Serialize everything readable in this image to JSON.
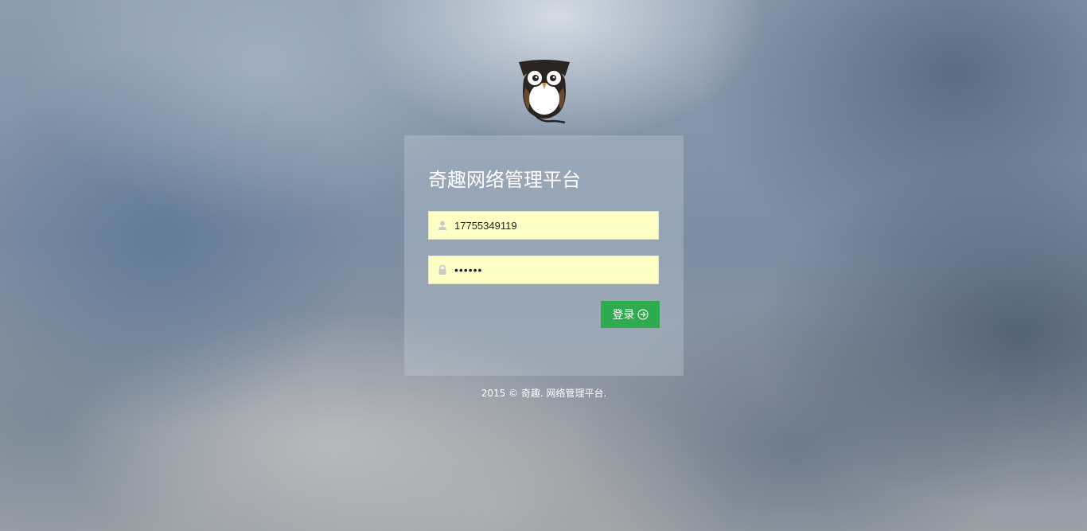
{
  "title": "奇趣网络管理平台",
  "login_form": {
    "username": {
      "value": "17755349119",
      "icon": "user-icon"
    },
    "password": {
      "value": "••••••",
      "icon": "lock-icon"
    },
    "submit": {
      "label": "登录",
      "icon": "circle-arrow-right-icon",
      "color": "#2eab4e"
    }
  },
  "footer": {
    "text": "2015 © 奇趣. 网络管理平台."
  },
  "colors": {
    "input_background": "#fdffc4"
  }
}
